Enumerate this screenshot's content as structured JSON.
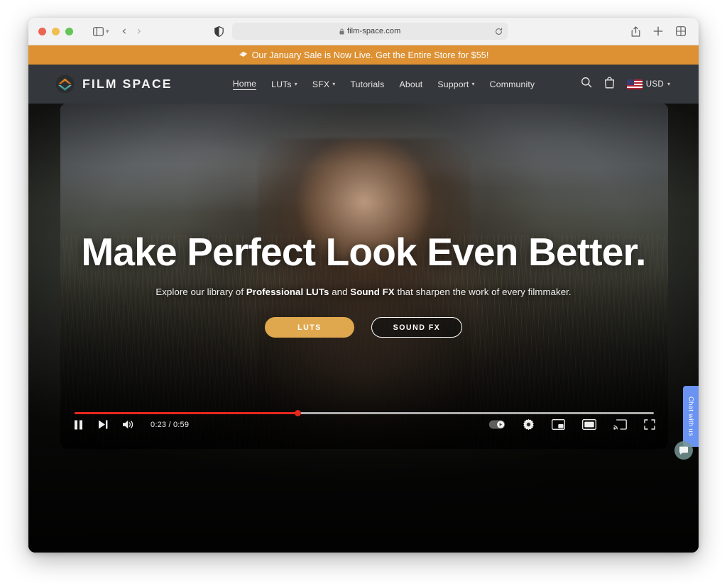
{
  "browser": {
    "traffic_lights": [
      "close",
      "minimize",
      "maximize"
    ],
    "sidebar_icon": "sidebar-icon",
    "back_label": "‹",
    "forward_label": "›",
    "shield_icon": "privacy-shield-icon",
    "url": "film-space.com",
    "lock_icon": "lock-icon",
    "reload_icon": "reload-icon",
    "share_icon": "share-icon",
    "new_tab_icon": "plus-icon",
    "tab_overview_icon": "tab-overview-icon"
  },
  "announcement": {
    "icon": "tag-icon",
    "text": "Our January Sale is Now Live. Get the Entire Store for $55!",
    "background": "#dd9133",
    "color": "#ffffff"
  },
  "header": {
    "background": "#34373b",
    "brand_name": "FILM SPACE",
    "brand_mark": "film-space-logo-icon",
    "nav": [
      {
        "label": "Home",
        "has_caret": false,
        "active": true
      },
      {
        "label": "LUTs",
        "has_caret": true,
        "active": false
      },
      {
        "label": "SFX",
        "has_caret": true,
        "active": false
      },
      {
        "label": "Tutorials",
        "has_caret": false,
        "active": false
      },
      {
        "label": "About",
        "has_caret": false,
        "active": false
      },
      {
        "label": "Support",
        "has_caret": true,
        "active": false
      },
      {
        "label": "Community",
        "has_caret": false,
        "active": false
      }
    ],
    "search_icon": "search-icon",
    "cart_icon": "shopping-bag-icon",
    "currency": "USD",
    "currency_caret": "⌄",
    "flag": "us-flag-icon"
  },
  "hero": {
    "title": "Make Perfect Look Even Better.",
    "subtitle_parts": [
      {
        "text": "Explore our library of ",
        "bold": false
      },
      {
        "text": "Professional LUTs",
        "bold": true
      },
      {
        "text": " and ",
        "bold": false
      },
      {
        "text": "Sound FX",
        "bold": true
      },
      {
        "text": " that sharpen the work of every filmmaker.",
        "bold": false
      }
    ],
    "subtitle_plain": "Explore our library of Professional LUTs and Sound FX that sharpen the work of every filmmaker.",
    "cta_primary": "LUTS",
    "cta_secondary": "SOUND FX",
    "cta_primary_color": "#e0a84e"
  },
  "player": {
    "current_time": "0:23",
    "duration": "0:59",
    "time_display": "0:23 / 0:59",
    "progress_percent": 38.5,
    "progress_color": "#e8271d",
    "pause_icon": "pause-icon",
    "next_icon": "next-track-icon",
    "volume_icon": "volume-icon",
    "autoplay_icon": "autoplay-toggle-icon",
    "settings_icon": "gear-icon",
    "pip_icon": "picture-in-picture-icon",
    "theater_icon": "theater-mode-icon",
    "cast_icon": "cast-icon",
    "fullscreen_icon": "fullscreen-icon"
  },
  "chat_widget": {
    "tab_label": "Chat with us",
    "bubble_icon": "chat-bubble-icon",
    "color": "#6a93f2"
  }
}
